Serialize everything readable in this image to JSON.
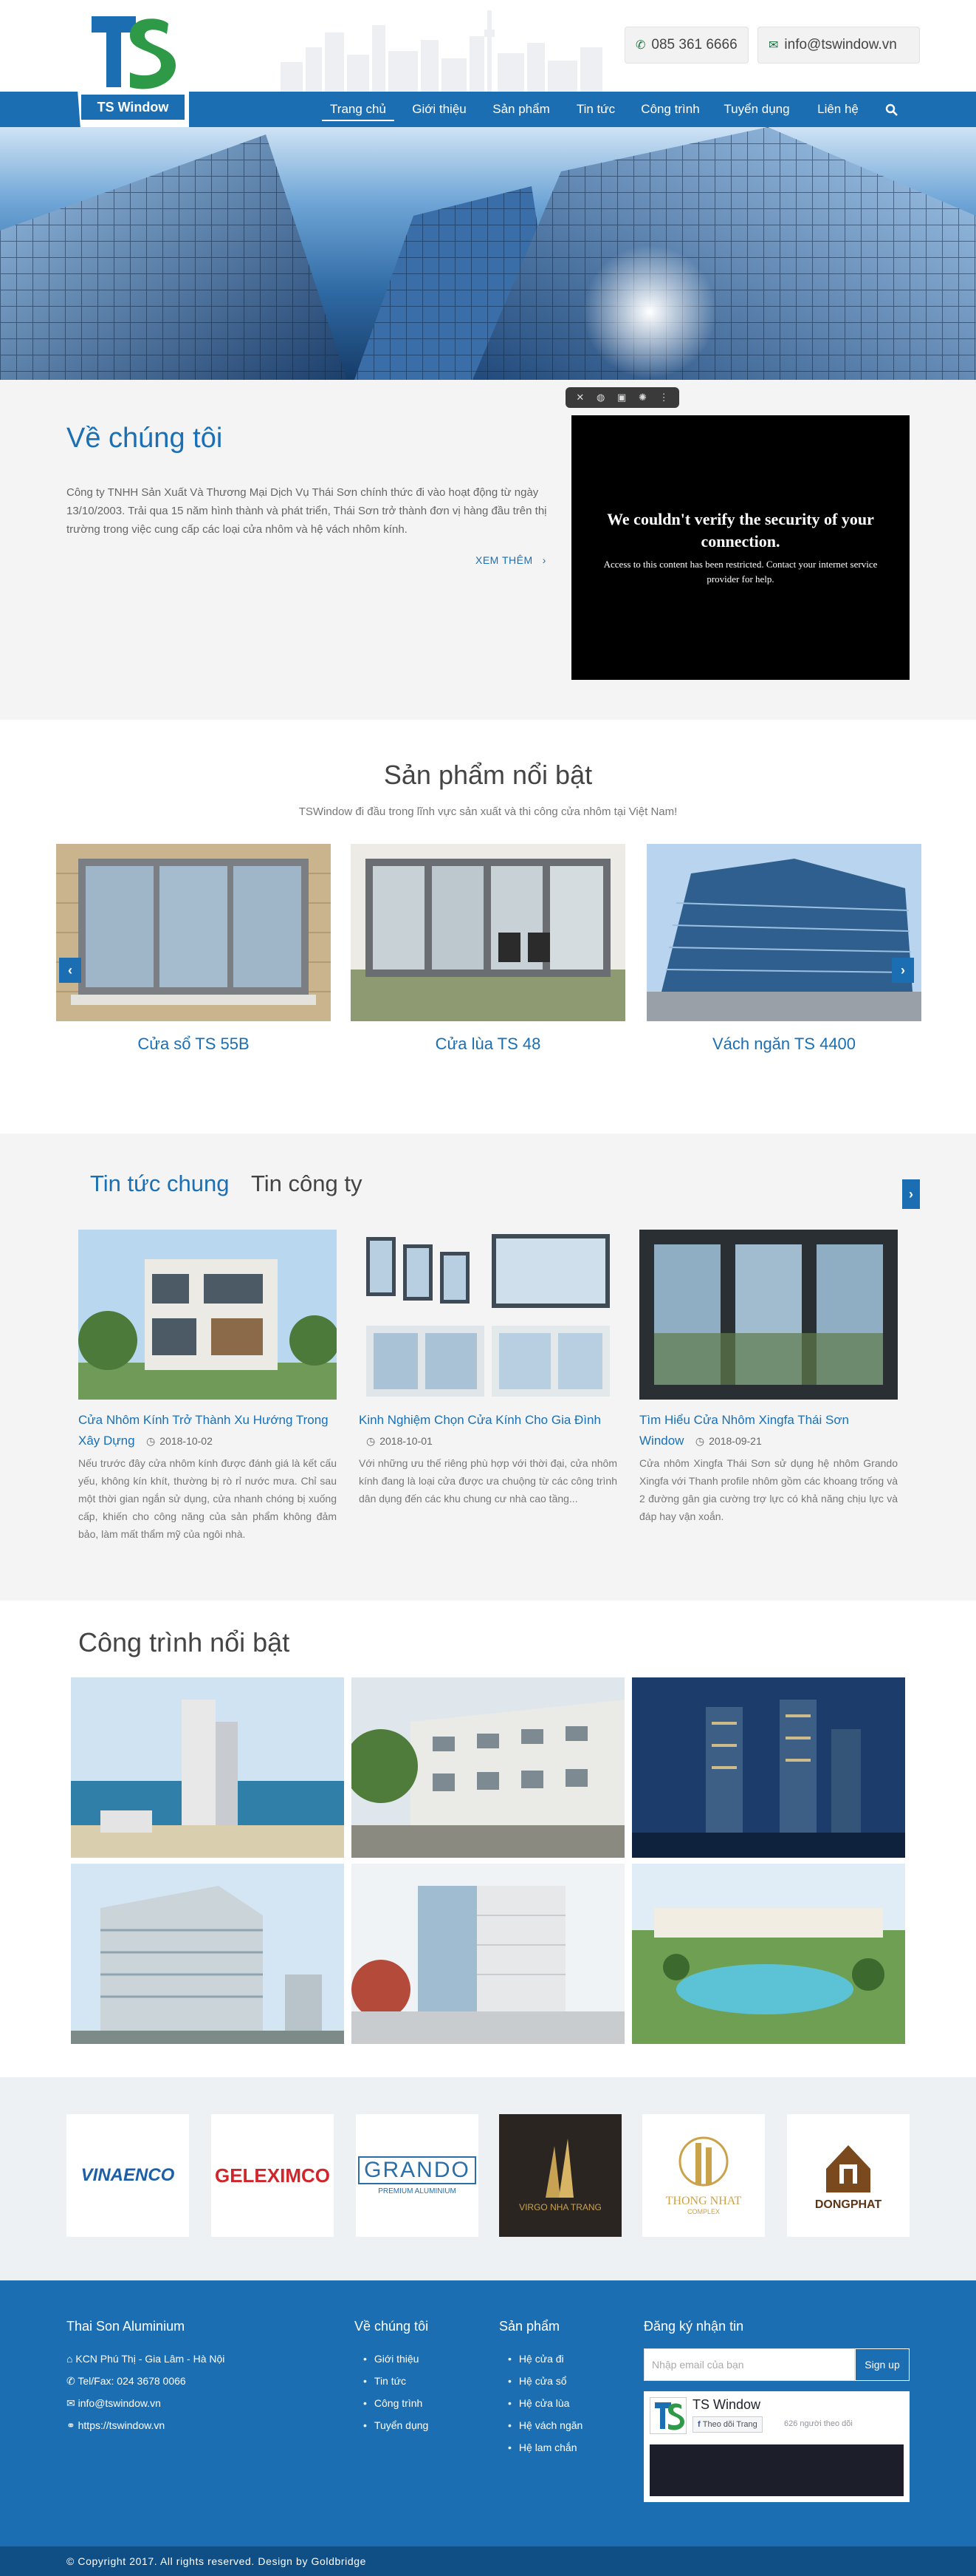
{
  "header": {
    "logo_text": "TS Window",
    "phone": "085 361 6666",
    "email": "info@tswindow.vn",
    "nav": [
      {
        "label": "Trang chủ"
      },
      {
        "label": "Giới thiệu"
      },
      {
        "label": "Sản phẩm"
      },
      {
        "label": "Tin tức"
      },
      {
        "label": "Công trình"
      },
      {
        "label": "Tuyển dụng"
      },
      {
        "label": "Liên hệ"
      }
    ],
    "active_nav": "Trang chủ"
  },
  "about": {
    "title": "Về chúng tôi",
    "text": "Công ty TNHH Sản Xuất Và Thương Mại Dịch Vụ Thái Sơn chính thức đi vào hoạt động từ ngày 13/10/2003. Trải qua 15 năm hình thành và phát triển, Thái Sơn trở thành đơn vị hàng đầu trên thị trường trong việc cung cấp các loại cửa nhôm và hệ vách nhôm kính.",
    "more": "XEM THÊM",
    "video_error_title": "We couldn't verify the security of your connection.",
    "video_error_text": "Access to this content has been restricted. Contact your internet service provider for help."
  },
  "products": {
    "title": "Sản phẩm nổi bật",
    "subtitle": "TSWindow đi đầu trong lĩnh vực sản xuất và thi công cửa nhôm tại Việt Nam!",
    "items": [
      {
        "title": "Cửa sổ TS 55B"
      },
      {
        "title": "Cửa lùa TS 48"
      },
      {
        "title": "Vách ngăn TS 4400"
      }
    ]
  },
  "news": {
    "tabs": [
      "Tin tức chung",
      "Tin công ty"
    ],
    "items": [
      {
        "title": "Cửa Nhôm Kính Trở Thành Xu Hướng Trong Xây Dựng",
        "date": "2018-10-02",
        "text": "Nếu trước đây cửa nhôm kính được đánh giá là kết cấu yếu, không kín khít, thường bị rò rỉ nước mưa. Chỉ sau một thời gian ngắn sử dụng, cửa nhanh chóng bị xuống cấp, khiến cho công năng của sản phẩm không đảm bảo, làm mất thẩm mỹ của ngôi nhà."
      },
      {
        "title": "Kinh Nghiệm Chọn Cửa Kính Cho Gia Đình",
        "date": "2018-10-01",
        "text": "Với những ưu thế riêng phù hợp với thời đại, cửa nhôm kính đang là loại cửa được ưa chuộng từ các công trình dân dụng đến các khu chung cư nhà cao tầng..."
      },
      {
        "title": "Tìm Hiểu Cửa Nhôm Xingfa Thái Sơn Window",
        "date": "2018-09-21",
        "text": "Cửa nhôm Xingfa Thái Sơn sử dụng hệ nhôm Grando Xingfa với Thanh profile nhôm gồm các khoang trống và 2 đường gân gia cường trợ lực có khả năng chịu lực và đáp hay vận xoắn."
      }
    ]
  },
  "projects": {
    "title": "Công trình nổi bật"
  },
  "partners": [
    {
      "name": "VINAENCO"
    },
    {
      "name": "GELEXIMCO"
    },
    {
      "name": "GRANDO",
      "sub": "PREMIUM ALUMINIUM"
    },
    {
      "name": "VIRGO NHA TRANG"
    },
    {
      "name": "THONG NHAT",
      "sub": "COMPLEX"
    },
    {
      "name": "DONGPHAT"
    }
  ],
  "footer": {
    "company": "Thai Son Aluminium",
    "address": "KCN Phú Thị - Gia Lâm - Hà Nội",
    "tel": "Tel/Fax: 024 3678 0066",
    "email": "info@tswindow.vn",
    "website": "https://tswindow.vn",
    "about_title": "Về chúng tôi",
    "about_links": [
      "Giới thiệu",
      "Tin tức",
      "Công trình",
      "Tuyển dụng"
    ],
    "products_title": "Sản phẩm",
    "product_links": [
      "Hệ cửa đi",
      "Hệ cửa sổ",
      "Hệ cửa lùa",
      "Hệ vách ngăn",
      "Hệ lam chắn"
    ],
    "subscribe_title": "Đăng ký nhận tin",
    "email_placeholder": "Nhập email của bạn",
    "signup": "Sign up",
    "fb_name": "TS Window",
    "fb_follow": "Theo dõi Trang",
    "fb_count": "626 người theo dõi",
    "copyright": "© Copyright 2017. All rights reserved. Design by Goldbridge"
  }
}
